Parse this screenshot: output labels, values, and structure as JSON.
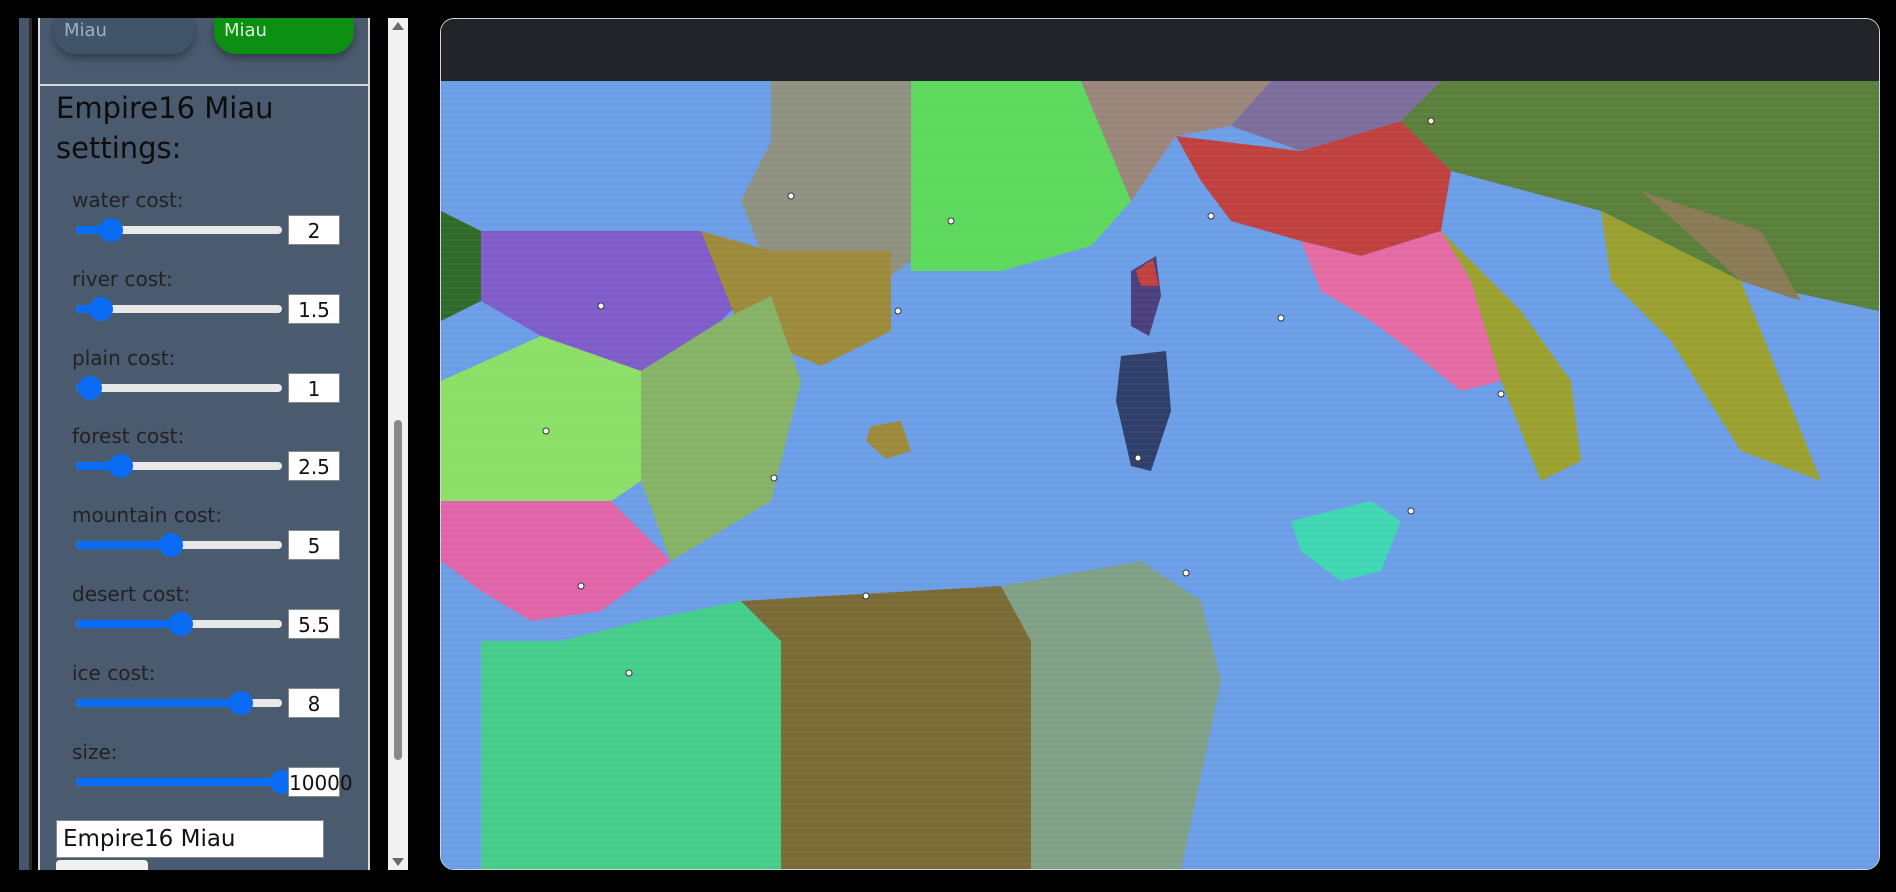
{
  "top_buttons": [
    "Miau",
    "Miau"
  ],
  "settings": {
    "title": "Empire16 Miau settings:",
    "sliders": [
      {
        "label": "water cost:",
        "value": "2",
        "level": 0.17
      },
      {
        "label": "river cost:",
        "value": "1.5",
        "level": 0.12
      },
      {
        "label": "plain cost:",
        "value": "1",
        "level": 0.07
      },
      {
        "label": "forest cost:",
        "value": "2.5",
        "level": 0.22
      },
      {
        "label": "mountain cost:",
        "value": "5",
        "level": 0.46
      },
      {
        "label": "desert cost:",
        "value": "5.5",
        "level": 0.51
      },
      {
        "label": "ice cost:",
        "value": "8",
        "level": 0.8
      },
      {
        "label": "size:",
        "value": "10000",
        "level": 1.0
      }
    ],
    "name_value": "Empire16 Miau"
  },
  "colors": {
    "sea": "#6b9ee6",
    "accent": "#0a6cf5",
    "panel": "#4a5b70",
    "active_button": "#0d8f14"
  }
}
